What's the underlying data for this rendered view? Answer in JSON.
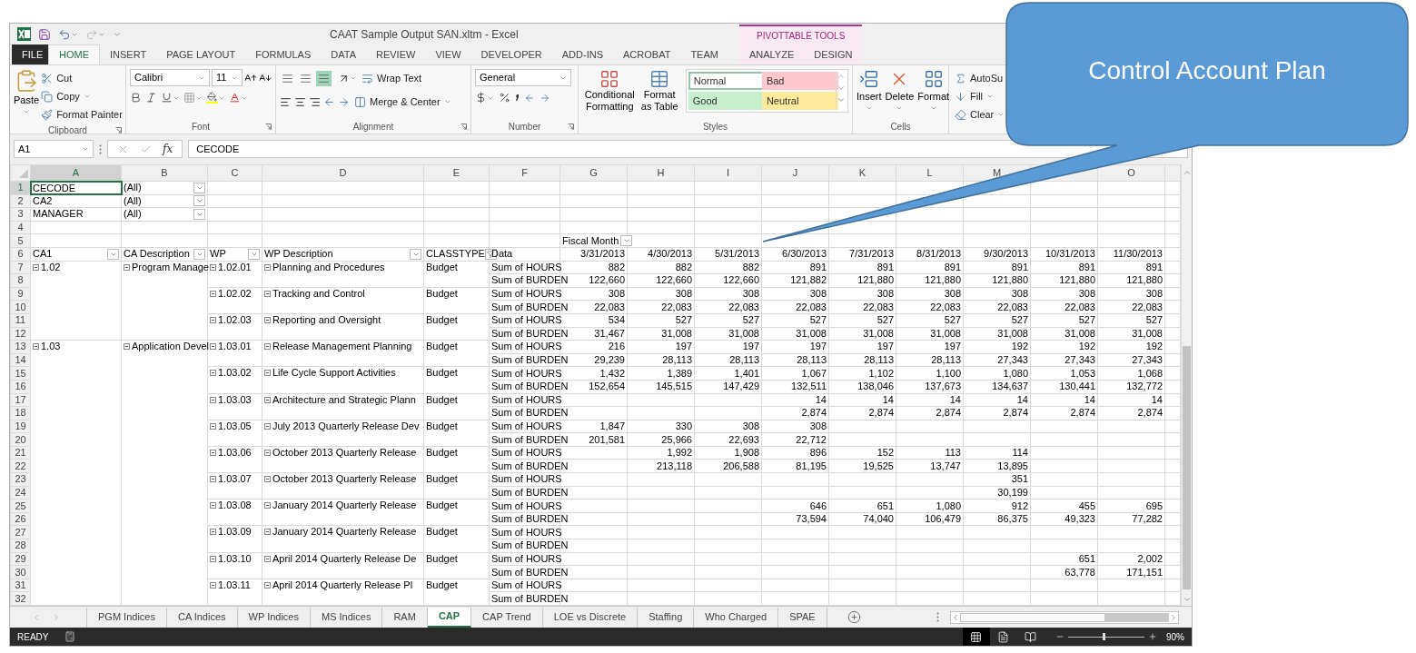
{
  "title_bar": {
    "title": "CAAT Sample Output SAN.xltm - Excel"
  },
  "ribbon_tabs": [
    {
      "label": "FILE",
      "kind": "file",
      "selected": false
    },
    {
      "label": "HOME",
      "kind": "tab",
      "selected": true
    },
    {
      "label": "INSERT",
      "kind": "tab",
      "selected": false
    },
    {
      "label": "PAGE LAYOUT",
      "kind": "tab",
      "selected": false
    },
    {
      "label": "FORMULAS",
      "kind": "tab",
      "selected": false
    },
    {
      "label": "DATA",
      "kind": "tab",
      "selected": false
    },
    {
      "label": "REVIEW",
      "kind": "tab",
      "selected": false
    },
    {
      "label": "VIEW",
      "kind": "tab",
      "selected": false
    },
    {
      "label": "DEVELOPER",
      "kind": "tab",
      "selected": false
    },
    {
      "label": "ADD-INS",
      "kind": "tab",
      "selected": false
    },
    {
      "label": "ACROBAT",
      "kind": "tab",
      "selected": false
    },
    {
      "label": "TEAM",
      "kind": "tab",
      "selected": false
    }
  ],
  "contextual_tabs": {
    "label": "PIVOTTABLE TOOLS",
    "tabs": [
      {
        "label": "ANALYZE",
        "selected": false
      },
      {
        "label": "DESIGN",
        "selected": false
      }
    ]
  },
  "ribbon": {
    "clipboard": {
      "label": "Clipboard",
      "paste": "Paste",
      "cut": "Cut",
      "copy": "Copy",
      "format_painter": "Format Painter"
    },
    "font": {
      "label": "Font",
      "font_name": "Calibri",
      "font_size": "11"
    },
    "alignment": {
      "label": "Alignment",
      "vertical_alignment": [
        {
          "selected": false
        },
        {
          "selected": false
        },
        {
          "selected": true
        }
      ],
      "wrap_text": "Wrap Text",
      "merge": "Merge & Center"
    },
    "number": {
      "label": "Number",
      "format": "General"
    },
    "styles": {
      "label": "Styles",
      "conditional": "Conditional Formatting",
      "format_table": "Format as Table",
      "gallery": [
        {
          "label": "Normal",
          "color": "#ffffff",
          "selected": true
        },
        {
          "label": "Bad",
          "color": "#ffc7ce",
          "selected": false
        },
        {
          "label": "Good",
          "color": "#c6efce",
          "selected": false
        },
        {
          "label": "Neutral",
          "color": "#ffeb9c",
          "selected": false
        }
      ]
    },
    "cells": {
      "label": "Cells",
      "insert": "Insert",
      "delete": "Delete",
      "format": "Format"
    },
    "editing": {
      "autosum": "AutoSu",
      "fill": "Fill",
      "clear": "Clear"
    }
  },
  "formula_bar": {
    "name_box": "A1",
    "function_label": "fx",
    "formula": "CECODE"
  },
  "columns": [
    {
      "letter": "A",
      "selected": true
    },
    {
      "letter": "B",
      "selected": false
    },
    {
      "letter": "C",
      "selected": false
    },
    {
      "letter": "D",
      "selected": false
    },
    {
      "letter": "E",
      "selected": false
    },
    {
      "letter": "F",
      "selected": false
    },
    {
      "letter": "G",
      "selected": false
    },
    {
      "letter": "H",
      "selected": false
    },
    {
      "letter": "I",
      "selected": false
    },
    {
      "letter": "J",
      "selected": false
    },
    {
      "letter": "K",
      "selected": false
    },
    {
      "letter": "L",
      "selected": false
    },
    {
      "letter": "M",
      "selected": false
    },
    {
      "selected": false
    },
    {
      "letter": "O",
      "selected": false
    }
  ],
  "row_headers": [
    {
      "number": "1",
      "selected": true
    },
    {
      "number": "2",
      "selected": false
    },
    {
      "number": "3",
      "selected": false
    },
    {
      "number": "4",
      "selected": false
    },
    {
      "number": "5",
      "selected": false
    },
    {
      "number": "6",
      "selected": false
    },
    {
      "number": "7",
      "selected": false
    },
    {
      "number": "8",
      "selected": false
    },
    {
      "number": "9",
      "selected": false
    },
    {
      "number": "10",
      "selected": false
    },
    {
      "number": "11",
      "selected": false
    },
    {
      "number": "12",
      "selected": false
    },
    {
      "number": "13",
      "selected": false
    },
    {
      "number": "14",
      "selected": false
    },
    {
      "number": "15",
      "selected": false
    },
    {
      "number": "16",
      "selected": false
    },
    {
      "number": "17",
      "selected": false
    },
    {
      "number": "18",
      "selected": false
    },
    {
      "number": "19",
      "selected": false
    },
    {
      "number": "20",
      "selected": false
    },
    {
      "number": "21",
      "selected": false
    },
    {
      "number": "22",
      "selected": false
    },
    {
      "number": "23",
      "selected": false
    },
    {
      "number": "24",
      "selected": false
    },
    {
      "number": "25",
      "selected": false
    },
    {
      "number": "26",
      "selected": false
    },
    {
      "number": "27",
      "selected": false
    },
    {
      "number": "28",
      "selected": false
    },
    {
      "number": "29",
      "selected": false
    },
    {
      "number": "30",
      "selected": false
    },
    {
      "number": "31",
      "selected": false
    },
    {
      "number": "32",
      "selected": false
    }
  ],
  "pivot": {
    "filters": [
      {
        "field": "CECODE",
        "value": "(All)",
        "selected": true
      },
      {
        "field": "CA2",
        "value": "(All)",
        "selected": false
      },
      {
        "field": "MANAGER",
        "value": "(All)",
        "selected": false
      }
    ],
    "column_field": "Fiscal Month",
    "row_fields": [
      {
        "label": "CA1",
        "filtered": false
      },
      {
        "label": "CA Description",
        "filtered": false
      },
      {
        "label": "WP",
        "filtered": false
      },
      {
        "label": "WP Description",
        "filtered": false
      },
      {
        "label": "CLASSTYPE",
        "filtered": true
      }
    ],
    "data_header": "Data",
    "months": [
      "3/31/2013",
      "4/30/2013",
      "5/31/2013",
      "6/30/2013",
      "7/31/2013",
      "8/31/2013",
      "9/30/2013",
      "10/31/2013",
      "11/30/2013"
    ],
    "groups": [
      {
        "ca1": "1.02",
        "ca_description": "Program Manage",
        "work_packages": [
          {
            "wp": "1.02.01",
            "description": "Planning and Procedures",
            "classtype": "Budget",
            "measures": [
              {
                "label": "Sum of HOURS",
                "values": {
                  "month_1": "882",
                  "month_2": "882",
                  "month_3": "882",
                  "month_4": "891",
                  "month_5": "891",
                  "month_6": "891",
                  "month_7": "891",
                  "month_8": "891",
                  "month_9": "891"
                }
              },
              {
                "label": "Sum of BURDEN",
                "values": {
                  "month_1": "122,660",
                  "month_2": "122,660",
                  "month_3": "122,660",
                  "month_4": "121,882",
                  "month_5": "121,880",
                  "month_6": "121,880",
                  "month_7": "121,880",
                  "month_8": "121,880",
                  "month_9": "121,880"
                }
              }
            ]
          },
          {
            "wp": "1.02.02",
            "description": "Tracking and Control",
            "classtype": "Budget",
            "measures": [
              {
                "label": "Sum of HOURS",
                "values": {
                  "month_1": "308",
                  "month_2": "308",
                  "month_3": "308",
                  "month_4": "308",
                  "month_5": "308",
                  "month_6": "308",
                  "month_7": "308",
                  "month_8": "308",
                  "month_9": "308"
                }
              },
              {
                "label": "Sum of BURDEN",
                "values": {
                  "month_1": "22,083",
                  "month_2": "22,083",
                  "month_3": "22,083",
                  "month_4": "22,083",
                  "month_5": "22,083",
                  "month_6": "22,083",
                  "month_7": "22,083",
                  "month_8": "22,083",
                  "month_9": "22,083"
                }
              }
            ]
          },
          {
            "wp": "1.02.03",
            "description": "Reporting and Oversight",
            "classtype": "Budget",
            "measures": [
              {
                "label": "Sum of HOURS",
                "values": {
                  "month_1": "534",
                  "month_2": "527",
                  "month_3": "527",
                  "month_4": "527",
                  "month_5": "527",
                  "month_6": "527",
                  "month_7": "527",
                  "month_8": "527",
                  "month_9": "527"
                }
              },
              {
                "label": "Sum of BURDEN",
                "values": {
                  "month_1": "31,467",
                  "month_2": "31,008",
                  "month_3": "31,008",
                  "month_4": "31,008",
                  "month_5": "31,008",
                  "month_6": "31,008",
                  "month_7": "31,008",
                  "month_8": "31,008",
                  "month_9": "31,008"
                }
              }
            ]
          }
        ]
      },
      {
        "ca1": "1.03",
        "ca_description": "Application Devel",
        "work_packages": [
          {
            "wp": "1.03.01",
            "description": "Release Management Planning",
            "classtype": "Budget",
            "measures": [
              {
                "label": "Sum of HOURS",
                "values": {
                  "month_1": "216",
                  "month_2": "197",
                  "month_3": "197",
                  "month_4": "197",
                  "month_5": "197",
                  "month_6": "197",
                  "month_7": "192",
                  "month_8": "192",
                  "month_9": "192"
                }
              },
              {
                "label": "Sum of BURDEN",
                "values": {
                  "month_1": "29,239",
                  "month_2": "28,113",
                  "month_3": "28,113",
                  "month_4": "28,113",
                  "month_5": "28,113",
                  "month_6": "28,113",
                  "month_7": "27,343",
                  "month_8": "27,343",
                  "month_9": "27,343"
                }
              }
            ]
          },
          {
            "wp": "1.03.02",
            "description": "Life Cycle Support Activities",
            "classtype": "Budget",
            "measures": [
              {
                "label": "Sum of HOURS",
                "values": {
                  "month_1": "1,432",
                  "month_2": "1,389",
                  "month_3": "1,401",
                  "month_4": "1,067",
                  "month_5": "1,102",
                  "month_6": "1,100",
                  "month_7": "1,080",
                  "month_8": "1,053",
                  "month_9": "1,068"
                }
              },
              {
                "label": "Sum of BURDEN",
                "values": {
                  "month_1": "152,654",
                  "month_2": "145,515",
                  "month_3": "147,429",
                  "month_4": "132,511",
                  "month_5": "138,046",
                  "month_6": "137,673",
                  "month_7": "134,637",
                  "month_8": "130,441",
                  "month_9": "132,772"
                }
              }
            ]
          },
          {
            "wp": "1.03.03",
            "description": "Architecture and Strategic Plann",
            "classtype": "Budget",
            "measures": [
              {
                "label": "Sum of HOURS",
                "values": {
                  "month_4": "14",
                  "month_5": "14",
                  "month_6": "14",
                  "month_7": "14",
                  "month_8": "14",
                  "month_9": "14"
                }
              },
              {
                "label": "Sum of BURDEN",
                "values": {
                  "month_4": "2,874",
                  "month_5": "2,874",
                  "month_6": "2,874",
                  "month_7": "2,874",
                  "month_8": "2,874",
                  "month_9": "2,874"
                }
              }
            ]
          },
          {
            "wp": "1.03.05",
            "description": "July 2013 Quarterly Release Dev",
            "classtype": "Budget",
            "measures": [
              {
                "label": "Sum of HOURS",
                "values": {
                  "month_1": "1,847",
                  "month_2": "330",
                  "month_3": "308",
                  "month_4": "308"
                }
              },
              {
                "label": "Sum of BURDEN",
                "values": {
                  "month_1": "201,581",
                  "month_2": "25,966",
                  "month_3": "22,693",
                  "month_4": "22,712"
                }
              }
            ]
          },
          {
            "wp": "1.03.06",
            "description": "October 2013 Quarterly Release",
            "classtype": "Budget",
            "measures": [
              {
                "label": "Sum of HOURS",
                "values": {
                  "month_2": "1,992",
                  "month_3": "1,908",
                  "month_4": "896",
                  "month_5": "152",
                  "month_6": "113",
                  "month_7": "114"
                }
              },
              {
                "label": "Sum of BURDEN",
                "values": {
                  "month_2": "213,118",
                  "month_3": "206,588",
                  "month_4": "81,195",
                  "month_5": "19,525",
                  "month_6": "13,747",
                  "month_7": "13,895"
                }
              }
            ]
          },
          {
            "wp": "1.03.07",
            "description": "October 2013 Quarterly Release",
            "classtype": "Budget",
            "measures": [
              {
                "label": "Sum of HOURS",
                "values": {
                  "month_7": "351"
                }
              },
              {
                "label": "Sum of BURDEN",
                "values": {
                  "month_7": "30,199"
                }
              }
            ]
          },
          {
            "wp": "1.03.08",
            "description": "January 2014 Quarterly Release",
            "classtype": "Budget",
            "measures": [
              {
                "label": "Sum of HOURS",
                "values": {
                  "month_4": "646",
                  "month_5": "651",
                  "month_6": "1,080",
                  "month_7": "912",
                  "month_8": "455",
                  "month_9": "695"
                }
              },
              {
                "label": "Sum of BURDEN",
                "values": {
                  "month_4": "73,594",
                  "month_5": "74,040",
                  "month_6": "106,479",
                  "month_7": "86,375",
                  "month_8": "49,323",
                  "month_9": "77,282"
                }
              }
            ]
          },
          {
            "wp": "1.03.09",
            "description": "January 2014 Quarterly Release",
            "classtype": "Budget",
            "measures": [
              {
                "label": "Sum of HOURS"
              },
              {
                "label": "Sum of BURDEN"
              }
            ]
          },
          {
            "wp": "1.03.10",
            "description": "April 2014 Quarterly Release De",
            "classtype": "Budget",
            "measures": [
              {
                "label": "Sum of HOURS",
                "values": {
                  "month_8": "651",
                  "month_9": "2,002"
                }
              },
              {
                "label": "Sum of BURDEN",
                "values": {
                  "month_8": "63,778",
                  "month_9": "171,151"
                }
              }
            ]
          },
          {
            "wp": "1.03.11",
            "description": "April 2014 Quarterly Release Pl",
            "classtype": "Budget",
            "measures": [
              {
                "label": "Sum of HOURS"
              },
              {
                "label": "Sum of BURDEN"
              }
            ]
          }
        ]
      }
    ]
  },
  "sheet_tabs": [
    {
      "label": "PGM Indices",
      "selected": false
    },
    {
      "label": "CA Indices",
      "selected": false
    },
    {
      "label": "WP Indices",
      "selected": false
    },
    {
      "label": "MS Indices",
      "selected": false
    },
    {
      "label": "RAM",
      "selected": false
    },
    {
      "label": "CAP",
      "selected": true
    },
    {
      "label": "CAP Trend",
      "selected": false
    },
    {
      "label": "LOE vs Discrete",
      "selected": false
    },
    {
      "label": "Staffing",
      "selected": false
    },
    {
      "label": "Who Charged",
      "selected": false
    },
    {
      "label": "SPAE",
      "selected": false
    }
  ],
  "status_bar": {
    "status": "READY",
    "views": [
      {
        "kind": "normal",
        "selected": true
      },
      {
        "kind": "page_layout",
        "selected": false
      },
      {
        "kind": "page_break",
        "selected": false
      }
    ],
    "zoom": {
      "level": 0.47,
      "reading": "90%"
    }
  },
  "callout": {
    "text": "Control Account Plan"
  }
}
